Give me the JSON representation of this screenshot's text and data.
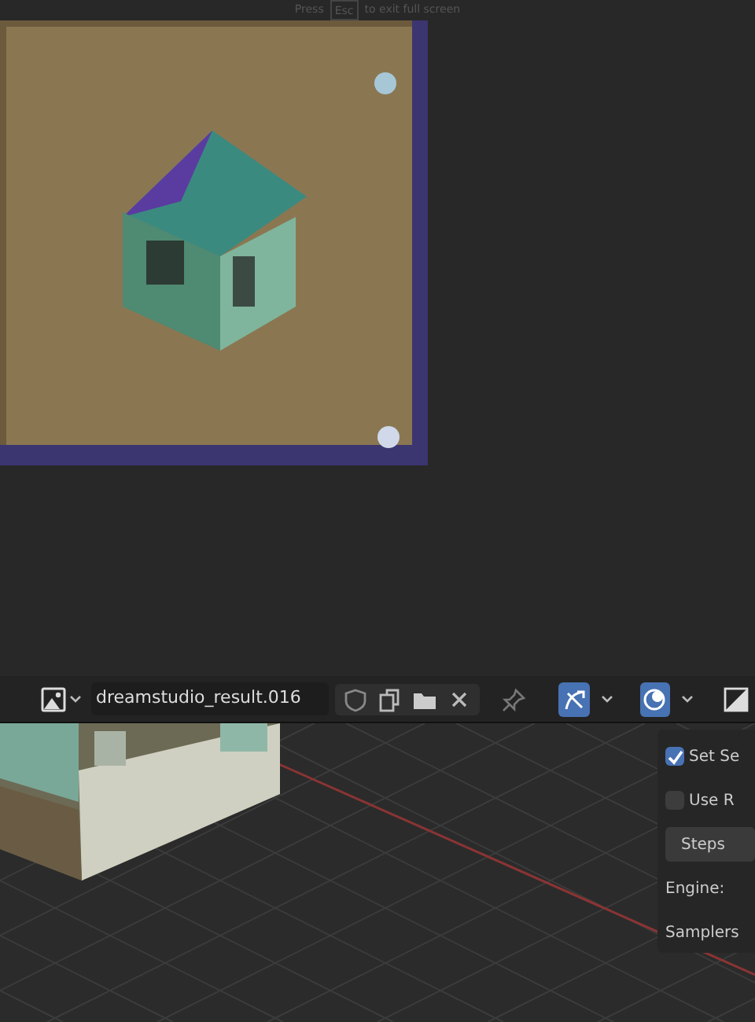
{
  "fullscreen_hint": [
    "Press",
    "Esc",
    "to exit full screen"
  ],
  "image_editor": {
    "header": {
      "image_name": "dreamstudio_result.016",
      "toggles": [
        {
          "kind": "overlay",
          "on": true
        },
        {
          "kind": "shading",
          "on": true
        }
      ]
    }
  },
  "viewport": {
    "panel": {
      "items": [
        {
          "kind": "checkbox",
          "label": "Set Se",
          "checked": true
        },
        {
          "kind": "checkbox",
          "label": "Use R",
          "checked": false
        },
        {
          "kind": "button",
          "label": "Steps"
        },
        {
          "kind": "label",
          "label": "Engine:"
        },
        {
          "kind": "label",
          "label": "Samplers"
        }
      ]
    }
  }
}
